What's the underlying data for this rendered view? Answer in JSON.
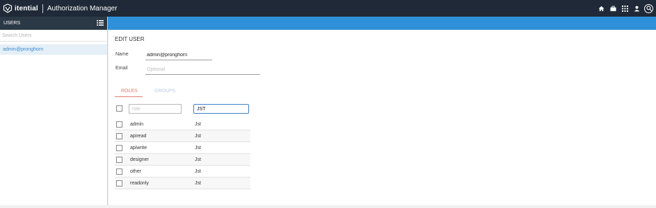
{
  "app": {
    "brand": "itential",
    "title": "Authorization Manager"
  },
  "topbar_icons": [
    "home-icon",
    "briefcase-icon",
    "apps-grid-icon",
    "user-icon",
    "search-icon"
  ],
  "sidebar": {
    "title": "USERS",
    "search_placeholder": "Search Users",
    "items": [
      {
        "label": "admin@pronghorn",
        "selected": true
      }
    ]
  },
  "edit_user": {
    "heading": "EDIT USER",
    "name_label": "Name",
    "name_value": "admin@pronghorn",
    "email_label": "Email",
    "email_placeholder": "Optional"
  },
  "tabs": [
    {
      "label": "ROLES",
      "active": true
    },
    {
      "label": "GROUPS",
      "active": false
    }
  ],
  "roles_table": {
    "filter_role_placeholder": "role",
    "filter_desc_value": "JST",
    "rows": [
      {
        "name": "admin",
        "desc": "Jst"
      },
      {
        "name": "apiread",
        "desc": "Jst"
      },
      {
        "name": "apiwrite",
        "desc": "Jst"
      },
      {
        "name": "designer",
        "desc": "Jst"
      },
      {
        "name": "other",
        "desc": "Jst"
      },
      {
        "name": "readonly",
        "desc": "Jst"
      }
    ]
  },
  "colors": {
    "topbar": "#1f2937",
    "accent_blue": "#2f8fd8",
    "active_tab": "#e27c6f",
    "selected_user": "#3b8ad1"
  }
}
